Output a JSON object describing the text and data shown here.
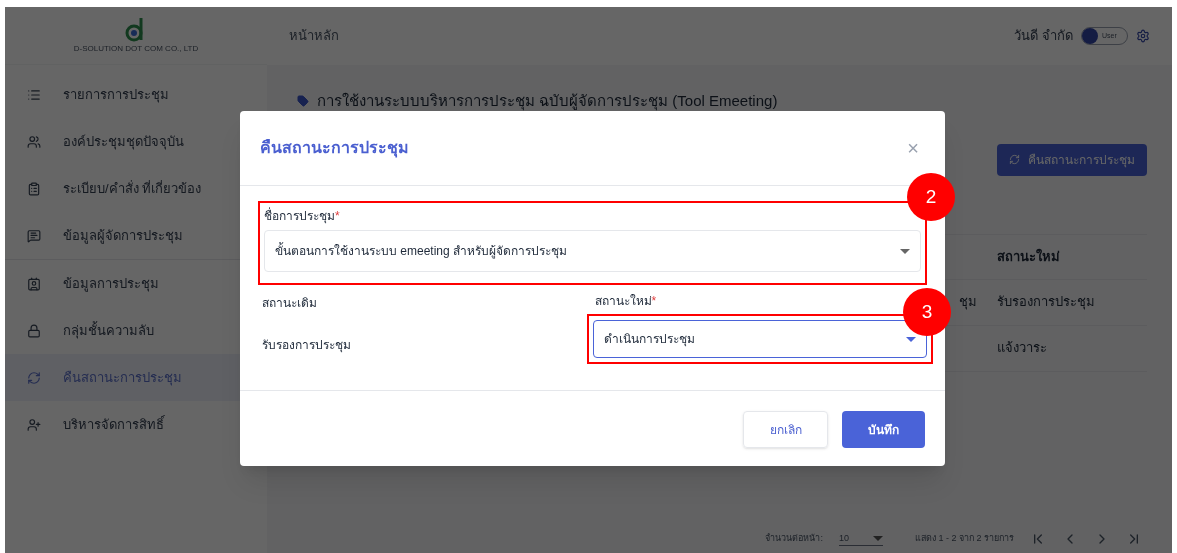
{
  "logo": {
    "company": "D-SOLUTION DOT COM CO., LTD"
  },
  "sidebar": {
    "items": [
      {
        "label": "รายการการประชุม",
        "selected": false
      },
      {
        "label": "องค์ประชุมชุดปัจจุบัน",
        "selected": false
      },
      {
        "label": "ระเบียบ/คำสั่ง ที่เกี่ยวข้อง",
        "selected": false
      },
      {
        "label": "ข้อมูลผู้จัดการประชุม",
        "selected": false
      },
      {
        "label": "ข้อมูลการประชุม",
        "selected": false
      },
      {
        "label": "กลุ่มชั้นความลับ",
        "selected": false
      },
      {
        "label": "คืนสถานะการประชุม",
        "selected": true
      },
      {
        "label": "บริหารจัดการสิทธิ์",
        "selected": false
      }
    ]
  },
  "header": {
    "breadcrumb": "หน้าหลัก",
    "user": "วันดี จำกัด",
    "role_toggle": "User"
  },
  "page": {
    "title": "การใช้งานระบบบริหารการประชุม ฉบับผู้จัดการประชุม (Tool Emeeting)",
    "action_button": "คืนสถานะการประชุม"
  },
  "table": {
    "column_header": "สถานะใหม่",
    "rows": [
      {
        "column_3": "ชุม",
        "new_status": "รับรองการประชุม"
      },
      {
        "new_status": "แจ้งวาระ"
      }
    ]
  },
  "pagination": {
    "per_page_label": "จำนวนต่อหน้า:",
    "per_page": "10",
    "range": "แสดง 1 - 2 จาก 2 รายการ"
  },
  "dialog": {
    "title": "คืนสถานะการประชุม",
    "close": "×",
    "meeting_field": {
      "label": "ชื่อการประชุม",
      "required_mark": "*",
      "value": "ขั้นตอนการใช้งานระบบ emeeting สำหรับผู้จัดการประชุม",
      "annotation": "2"
    },
    "old_status": {
      "label": "สถานะเดิม",
      "value": "รับรองการประชุม"
    },
    "new_status": {
      "label": "สถานะใหม่",
      "required_mark": "*",
      "value": "ดำเนินการประชุม",
      "annotation": "3"
    },
    "buttons": [
      "ยกเลิก",
      "บันทึก"
    ]
  }
}
